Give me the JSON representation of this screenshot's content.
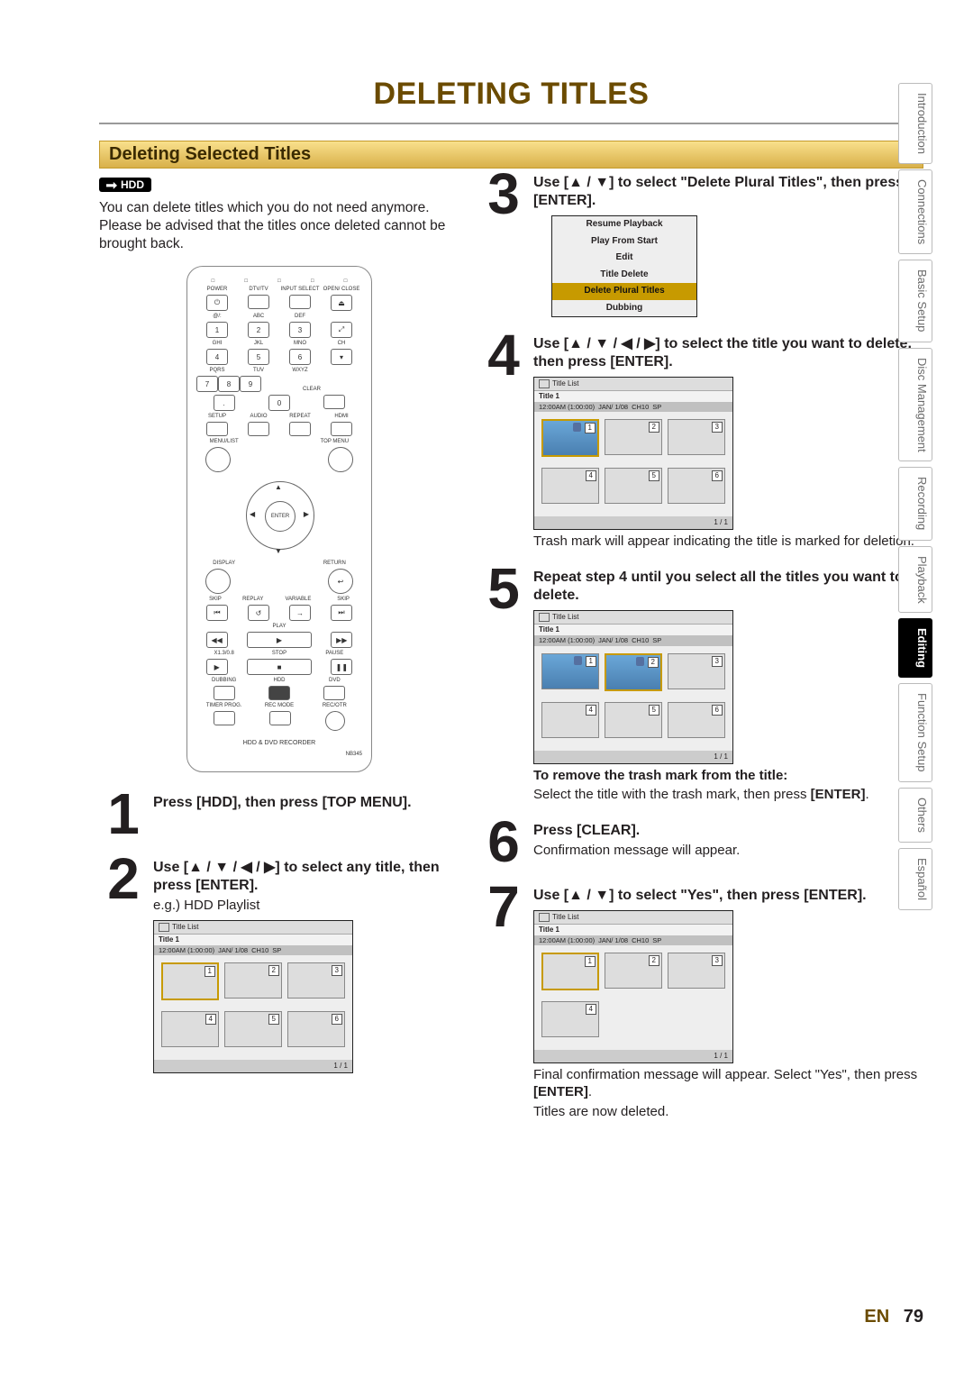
{
  "page_title": "DELETING TITLES",
  "section_header": "Deleting Selected Titles",
  "hdd_tag": "HDD",
  "intro": "You can delete titles which you do not need anymore. Please be advised that the titles once deleted cannot be brought back.",
  "remote": {
    "top_dots": [
      "□",
      "□",
      "□",
      "□",
      "□"
    ],
    "row1_labels": [
      "POWER",
      "DTV/TV",
      "INPUT SELECT",
      "OPEN/ CLOSE"
    ],
    "num_labels": [
      [
        "@/:",
        "ABC",
        "DEF"
      ],
      [
        "GHI",
        "JKL",
        "MNO"
      ],
      [
        "PQRS",
        "TUV",
        "WXYZ"
      ]
    ],
    "nums": [
      [
        "1",
        "2",
        "3"
      ],
      [
        "4",
        "5",
        "6"
      ],
      [
        "7",
        "8",
        "9"
      ],
      [
        ".",
        "0",
        ""
      ]
    ],
    "ch_label": "CH",
    "clear_label": "CLEAR",
    "row_mid": [
      "SETUP",
      "AUDIO",
      "REPEAT",
      "HDMI"
    ],
    "menu_list": "MENU/LIST",
    "top_menu": "TOP MENU",
    "enter": "ENTER",
    "display": "DISPLAY",
    "return": "RETURN",
    "variable": "VARIABLE",
    "skip": "SKIP",
    "replay": "REPLAY",
    "play": "PLAY",
    "x_label": "X1.3/0.8",
    "stop": "STOP",
    "pause": "PAUSE",
    "dubbing": "DUBBING",
    "hdd": "HDD",
    "dvd": "DVD",
    "timer": "TIMER PROG.",
    "recmode": "REC MODE",
    "recotr": "REC/OTR",
    "brand": "HDD & DVD RECORDER",
    "model": "NB345"
  },
  "steps": {
    "s1": "Press [HDD], then press [TOP MENU].",
    "s2": "Use [▲ / ▼ / ◀ / ▶] to select any title, then press [ENTER].",
    "s2_eg": "e.g.) HDD Playlist",
    "s3": "Use [▲ / ▼] to select \"Delete Plural Titles\", then press [ENTER].",
    "s4": "Use [▲ / ▼ / ◀ / ▶] to select the title you want to delete, then press [ENTER].",
    "s4_note": "Trash mark will appear indicating the title is marked for deletion.",
    "s5": "Repeat step 4 until you select all the titles you want to delete.",
    "s5_sub_hdr": "To remove the trash mark from the title:",
    "s5_sub": "Select the title with the trash mark, then press ",
    "s5_sub_b": "[ENTER]",
    "s6": "Press [CLEAR].",
    "s6_note": "Confirmation message will appear.",
    "s7": "Use [▲ / ▼] to select \"Yes\", then press [ENTER].",
    "s7_note1": "Final confirmation message will appear. Select \"Yes\", then press ",
    "s7_note1b": "[ENTER]",
    "s7_note2": "Titles are now deleted."
  },
  "title_list": {
    "header": "Title List",
    "title": "Title 1",
    "time": "12:00AM (1:00:00)",
    "date": "JAN/ 1/08",
    "ch": "CH10",
    "sp": "SP",
    "pager": "1 / 1",
    "nums": [
      "1",
      "2",
      "3",
      "4",
      "5",
      "6"
    ]
  },
  "ctx_menu": {
    "items": [
      "Resume Playback",
      "Play From Start",
      "Edit",
      "Title Delete",
      "Delete Plural Titles",
      "Dubbing"
    ],
    "selected_index": 4
  },
  "tabs": [
    "Introduction",
    "Connections",
    "Basic Setup",
    "Disc Management",
    "Recording",
    "Playback",
    "Editing",
    "Function Setup",
    "Others",
    "Español"
  ],
  "active_tab_index": 6,
  "footer": {
    "lang": "EN",
    "page": "79"
  }
}
